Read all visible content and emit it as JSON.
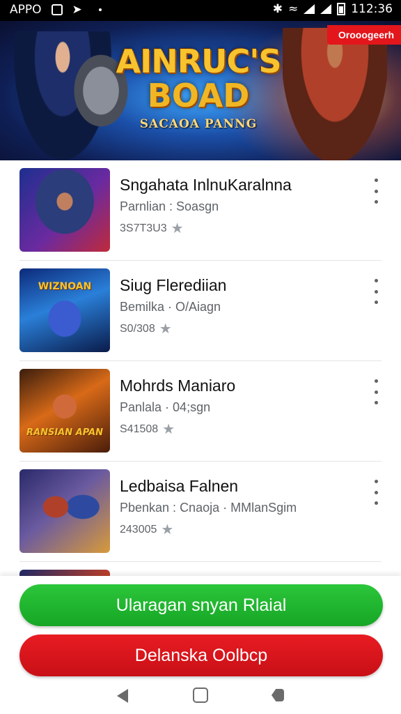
{
  "status_bar": {
    "left_text": "APPO",
    "time": "112:36"
  },
  "banner": {
    "title_line1": "AINRUC'S",
    "title_line2": "BOAD",
    "subtitle": "SACAOA PANNG",
    "badge": "Orooogeerh"
  },
  "games": [
    {
      "title": "Sngahata InlnuKaralnna",
      "subtitle": "Parnlian : Soasgn",
      "rating": "3S7T3U3"
    },
    {
      "title": "Siug Flerediian",
      "subtitle": "Bemilka · O/Aiagn",
      "rating": "S0/308",
      "thumb_text": "WIZNOAN"
    },
    {
      "title": "Mohrds Maniaro",
      "subtitle": "Panlala · 04;sgn",
      "rating": "S41508",
      "thumb_text": "RANSIAN APAN"
    },
    {
      "title": "Ledbaisa Falnen",
      "subtitle": "Pbenkan : Cnaoja · MMlanSgim",
      "rating": "243005"
    }
  ],
  "buttons": {
    "primary": "Ularagan snyan Rlaial",
    "secondary": "Delanska Oolbcp"
  },
  "colors": {
    "primary_button": "#1fb52f",
    "secondary_button": "#d8141b",
    "badge": "#e3161c"
  },
  "icons": [
    "bluetooth-icon",
    "wifi-icon",
    "signal-icon",
    "battery-icon",
    "star-icon",
    "more-vert-icon",
    "nav-back-icon",
    "nav-home-icon",
    "nav-recent-icon"
  ]
}
